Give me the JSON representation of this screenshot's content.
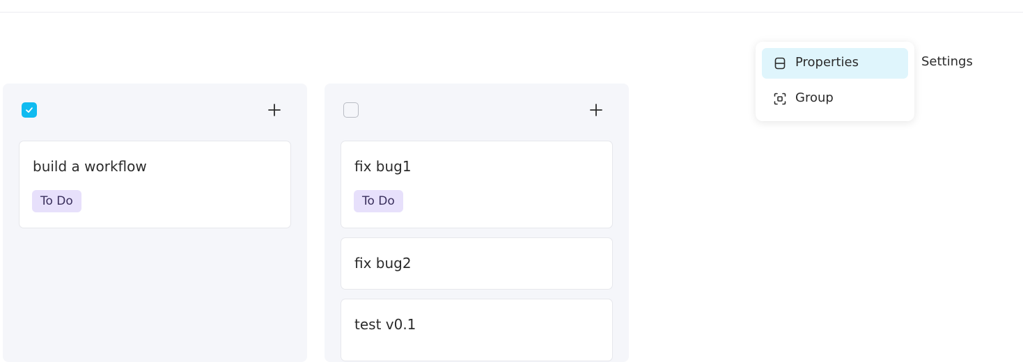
{
  "header": {
    "settings_label": "Settings"
  },
  "dropdown": {
    "items": [
      {
        "label": "Properties",
        "icon": "properties-icon",
        "active": true
      },
      {
        "label": "Group",
        "icon": "group-icon",
        "active": false
      }
    ]
  },
  "columns": [
    {
      "checked": true,
      "cards": [
        {
          "title": "build a workflow",
          "tag": "To Do"
        }
      ]
    },
    {
      "checked": false,
      "cards": [
        {
          "title": "fix bug1",
          "tag": "To Do"
        },
        {
          "title": "fix bug2"
        },
        {
          "title": "test v0.1"
        }
      ]
    }
  ],
  "colors": {
    "accent": "#10bbf0",
    "column_bg": "#f5f6fa",
    "tag_bg": "#e7e0fb",
    "menu_active_bg": "#dff5fc"
  }
}
